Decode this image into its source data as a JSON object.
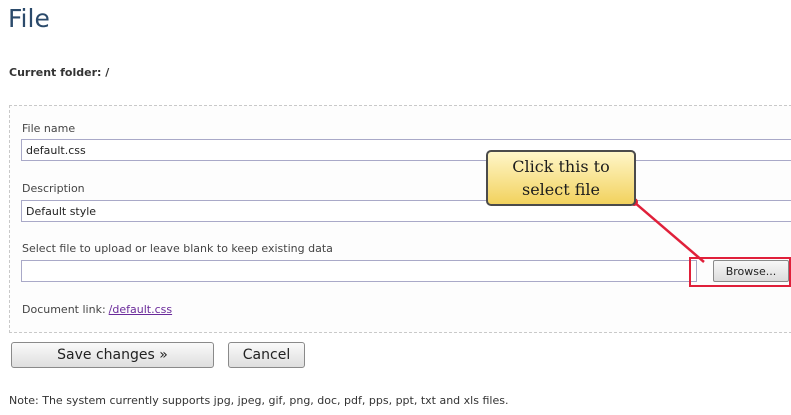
{
  "page": {
    "title": "File",
    "current_folder": "Current folder: /"
  },
  "form": {
    "file_name_label": "File name",
    "file_name_value": "default.css",
    "description_label": "Description",
    "description_value": "Default style",
    "upload_label": "Select file to upload or leave blank to keep existing data",
    "browse_label": "Browse...",
    "document_link_label": "Document link:",
    "document_link_value": "/default.css"
  },
  "callout": {
    "line1": "Click this to",
    "line2": "select file"
  },
  "buttons": {
    "save_label": "Save changes »",
    "cancel_label": "Cancel"
  },
  "note": "Note: The system currently supports jpg, jpeg, gif, png, doc, pdf, pps, ppt, txt and xls files.",
  "colors": {
    "title": "#2b4a6b",
    "highlight": "#e0203a",
    "callout_fill": "#f2d25e",
    "link": "#6a2a9a"
  }
}
